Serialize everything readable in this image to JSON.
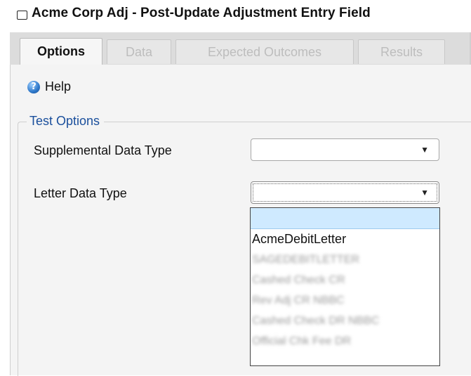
{
  "window": {
    "title": "Acme Corp Adj - Post-Update Adjustment Entry Field"
  },
  "tabs": [
    {
      "label": "Options",
      "active": true
    },
    {
      "label": "Data",
      "active": false
    },
    {
      "label": "Expected Outcomes",
      "active": false
    },
    {
      "label": "Results",
      "active": false
    }
  ],
  "help": {
    "icon": "help-question-icon",
    "label": "Help"
  },
  "test_options": {
    "legend": "Test Options",
    "supplemental_label": "Supplemental Data Type",
    "supplemental_value": "",
    "letter_label": "Letter Data Type",
    "letter_value": ""
  },
  "letter_dropdown": {
    "options": [
      "",
      "AcmeDebitLetter",
      "SAGEDEBITLETTER",
      "Cashed Check CR",
      "Rev Adj CR NBBC",
      "Cashed Check DR NBBC",
      "Official Chk Fee DR"
    ]
  },
  "colors": {
    "legend_blue": "#1a4f9c",
    "tab_bar": "#dcdcdc",
    "selected_option": "#cfeaff"
  }
}
